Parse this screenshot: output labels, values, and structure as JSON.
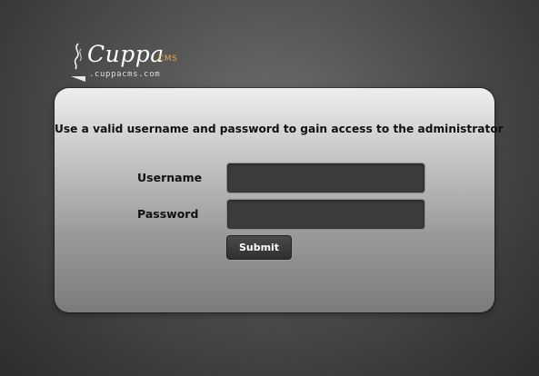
{
  "logo": {
    "name": "Cuppa",
    "suffix": "CMS",
    "url": ".cuppacms.com",
    "icon": "steam-swoosh-icon"
  },
  "login": {
    "message": "Use a valid username and password to gain access to the administrator",
    "username_label": "Username",
    "password_label": "Password",
    "username_value": "",
    "password_value": "",
    "submit_label": "Submit"
  },
  "colors": {
    "panel_top": "#eeeeee",
    "panel_bottom": "#7b7b7b",
    "input_bg": "#3c3c3c",
    "logo_accent": "#e2a84c"
  }
}
